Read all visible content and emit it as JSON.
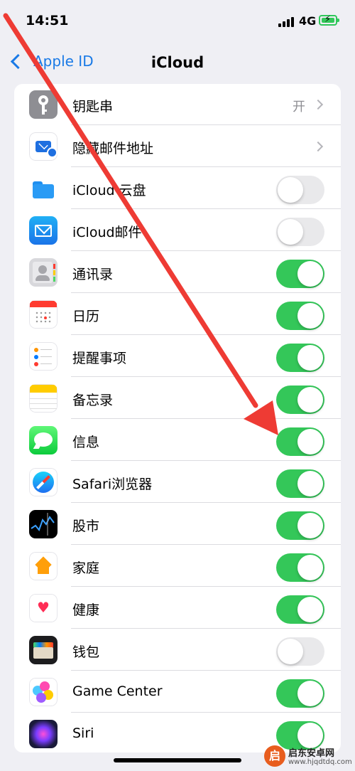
{
  "status_bar": {
    "time": "14:51",
    "network": "4G"
  },
  "nav": {
    "back_label": "Apple ID",
    "title": "iCloud"
  },
  "rows": [
    {
      "label": "钥匙串",
      "value": "开",
      "control": "chevron",
      "icon": "keychain-icon"
    },
    {
      "label": "隐藏邮件地址",
      "value": "",
      "control": "chevron",
      "icon": "hide-my-email-icon"
    },
    {
      "label": "iCloud 云盘",
      "control": "toggle",
      "on": false,
      "icon": "icloud-drive-icon"
    },
    {
      "label": "iCloud邮件",
      "control": "toggle",
      "on": false,
      "icon": "mail-icon"
    },
    {
      "label": "通讯录",
      "control": "toggle",
      "on": true,
      "icon": "contacts-icon"
    },
    {
      "label": "日历",
      "control": "toggle",
      "on": true,
      "icon": "calendar-icon"
    },
    {
      "label": "提醒事项",
      "control": "toggle",
      "on": true,
      "icon": "reminders-icon"
    },
    {
      "label": "备忘录",
      "control": "toggle",
      "on": true,
      "icon": "notes-icon"
    },
    {
      "label": "信息",
      "control": "toggle",
      "on": true,
      "icon": "messages-icon"
    },
    {
      "label": "Safari浏览器",
      "control": "toggle",
      "on": true,
      "icon": "safari-icon"
    },
    {
      "label": "股市",
      "control": "toggle",
      "on": true,
      "icon": "stocks-icon"
    },
    {
      "label": "家庭",
      "control": "toggle",
      "on": true,
      "icon": "home-icon"
    },
    {
      "label": "健康",
      "control": "toggle",
      "on": true,
      "icon": "health-icon"
    },
    {
      "label": "钱包",
      "control": "toggle",
      "on": false,
      "icon": "wallet-icon"
    },
    {
      "label": "Game Center",
      "control": "toggle",
      "on": true,
      "icon": "game-center-icon"
    },
    {
      "label": "Siri",
      "control": "toggle",
      "on": true,
      "icon": "siri-icon"
    }
  ],
  "watermark": {
    "logo_char": "启",
    "name": "启东安卓网",
    "url": "www.hjqdtdq.com"
  },
  "colors": {
    "accent": "#1a7ae6",
    "toggle_on": "#34c759",
    "toggle_off": "#e9e9eb",
    "arrow": "#ee3b34"
  }
}
